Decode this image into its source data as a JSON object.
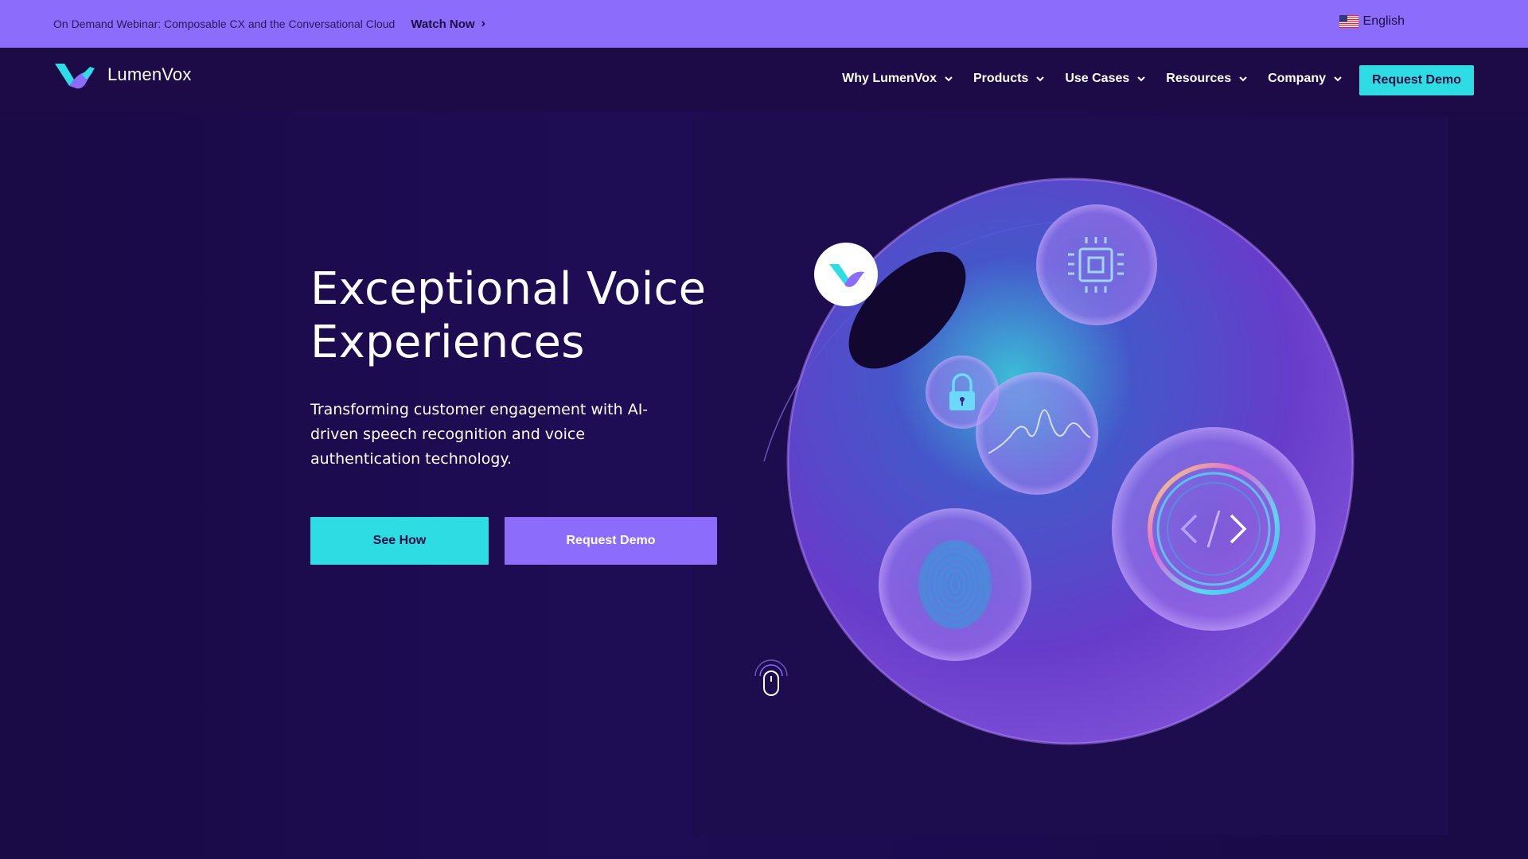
{
  "announcement": {
    "text": "On Demand Webinar: Composable CX and the Conversational Cloud",
    "link_label": "Watch Now",
    "language": "English"
  },
  "brand": {
    "name": "LumenVox"
  },
  "nav": {
    "items": [
      {
        "label": "Why LumenVox"
      },
      {
        "label": "Products"
      },
      {
        "label": "Use Cases"
      },
      {
        "label": "Resources"
      },
      {
        "label": "Company"
      }
    ],
    "cta_label": "Request Demo"
  },
  "hero": {
    "title_line1": "Exceptional Voice",
    "title_line2": "Experiences",
    "subtitle": "Transforming customer engagement with AI-driven speech recognition and voice authentication technology.",
    "primary_button": "See How",
    "secondary_button": "Request Demo"
  },
  "illustration_icons": [
    "lumenvox-logo-icon",
    "chip-icon",
    "lock-icon",
    "waveform-icon",
    "fingerprint-icon",
    "code-icon"
  ],
  "colors": {
    "announcement_bg": "#8c6dfb",
    "nav_bg": "#1d0b47",
    "accent_cyan": "#2ddde3",
    "accent_purple": "#8c6dfb"
  }
}
